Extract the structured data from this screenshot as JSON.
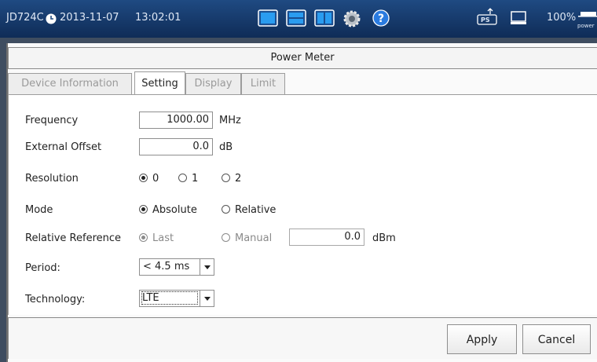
{
  "status_bar": {
    "device": "JD724C",
    "date": "2013-11-07",
    "time": "13:02:01",
    "battery": "100%",
    "battery_tag": "power",
    "ps_badge": "PS",
    "icons": [
      "clock-icon",
      "single-view-icon",
      "horizontal-split-icon",
      "vertical-split-icon",
      "settings-gear-icon",
      "help-icon",
      "usb-icon",
      "monitor-icon",
      "power-icon"
    ]
  },
  "window": {
    "title": "Power Meter"
  },
  "tabs": [
    {
      "label": "Device Information",
      "active": false
    },
    {
      "label": "Setting",
      "active": true
    },
    {
      "label": "Display",
      "active": false
    },
    {
      "label": "Limit",
      "active": false
    }
  ],
  "form": {
    "frequency": {
      "label": "Frequency",
      "value": "1000.00",
      "unit": "MHz"
    },
    "external_offset": {
      "label": "External Offset",
      "value": "0.0",
      "unit": "dB"
    },
    "resolution": {
      "label": "Resolution",
      "options": [
        "0",
        "1",
        "2"
      ],
      "selected": "0"
    },
    "mode": {
      "label": "Mode",
      "options": [
        "Absolute",
        "Relative"
      ],
      "selected": "Absolute"
    },
    "relative_reference": {
      "label": "Relative Reference",
      "options": [
        "Last",
        "Manual"
      ],
      "selected": "Last",
      "value": "0.0",
      "unit": "dBm"
    },
    "period": {
      "label": "Period:",
      "value": "< 4.5 ms"
    },
    "technology": {
      "label": "Technology:",
      "value": "LTE"
    }
  },
  "buttons": {
    "apply": "Apply",
    "cancel": "Cancel"
  },
  "colors": {
    "top_bar": "#1a3f74",
    "accent": "#1e6fd0"
  }
}
